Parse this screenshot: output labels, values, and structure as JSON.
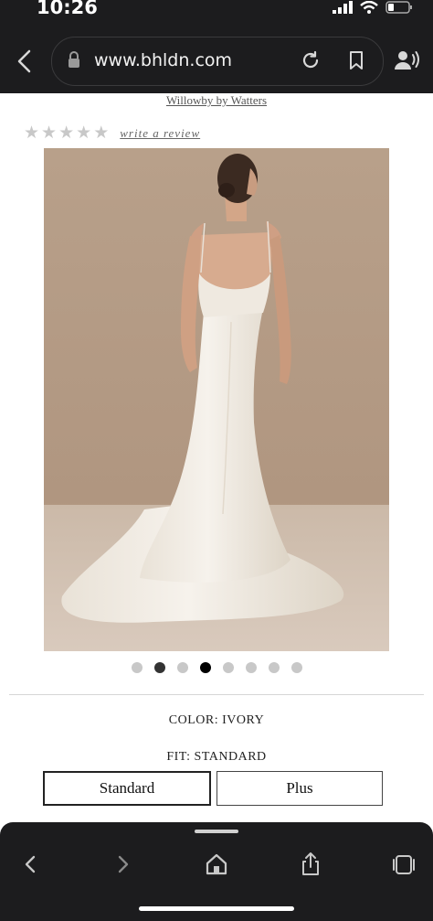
{
  "status_bar": {
    "time": "10:26"
  },
  "browser": {
    "url": "www.bhldn.com"
  },
  "product": {
    "brand": "Willowby by Watters",
    "review_link": "write a review",
    "stars": [
      "★",
      "★",
      "★",
      "★",
      "★"
    ],
    "rating": 0,
    "image_alt": "Woman in ivory backless mermaid wedding gown with train",
    "carousel": {
      "count": 8,
      "current": 4
    },
    "color_label": "COLOR: IVORY",
    "fit_label": "FIT: STANDARD",
    "fit_options": [
      "Standard",
      "Plus"
    ],
    "fit_selected": "Standard"
  },
  "icons": {
    "top": [
      "back-arrow-icon",
      "lock-icon",
      "reload-icon",
      "bookmark-icon",
      "reader-mode-icon"
    ],
    "bottom": [
      "back-icon",
      "forward-icon",
      "home-icon",
      "share-icon",
      "tabs-icon"
    ]
  },
  "colors": {
    "chrome": "#1c1c1e",
    "background": "#b59d88",
    "dress": "#f3efe8"
  }
}
